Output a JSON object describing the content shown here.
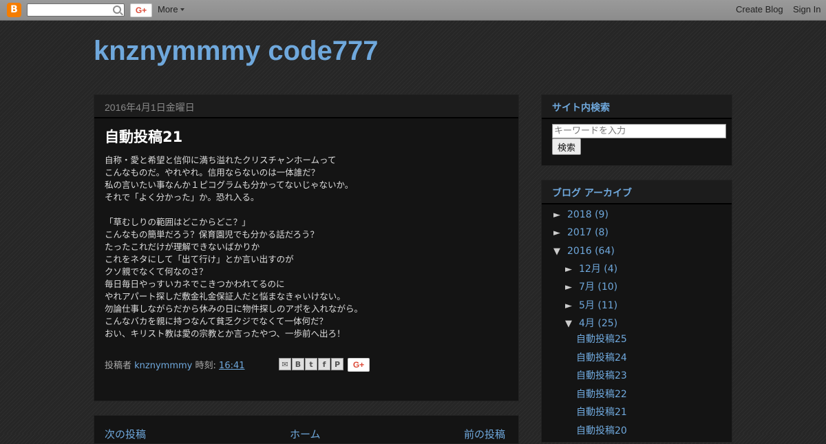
{
  "navbar": {
    "logo_glyph": "B",
    "gplus_label": "G+",
    "more_label": "More",
    "create_blog_label": "Create Blog",
    "sign_in_label": "Sign In"
  },
  "header": {
    "blog_title": "knznymmmy code777"
  },
  "post": {
    "date": "2016年4月1日金曜日",
    "title": "自動投稿21",
    "body_lines": [
      "自称・愛と希望と信仰に満ち溢れたクリスチャンホームって",
      "こんなものだ。やれやれ。信用ならないのは一体誰だ？",
      "私の言いたい事なんか１ピコグラムも分かってないじゃないか。",
      "それで「よく分かった」か。恐れ入る。",
      "",
      "「草むしりの範囲はどこからどこ？」",
      "こんなもの簡単だろう？保育園児でも分かる話だろう？",
      "たったこれだけが理解できないばかりか",
      "これをネタにして「出て行け」とか言い出すのが",
      "クソ親でなくて何なのさ？",
      "毎日毎日やっすいカネでこきつかわれてるのに",
      "やれアパート探しだ敷金礼金保証人だと悩まなきゃいけない。",
      "勿論仕事しながらだから休みの日に物件探しのアポを入れながら。",
      "こんなバカを親に持つなんて貧乏クジでなくて一体何だ？",
      "おい、キリスト教は愛の宗教とか言ったやつ、一歩前へ出ろ！"
    ],
    "posted_by_label": "投稿者",
    "author": "knznymmmy",
    "time_label": "時刻:",
    "time": "16:41",
    "share_gplus_label": "G+"
  },
  "pager": {
    "newer": "次の投稿",
    "home": "ホーム",
    "older": "前の投稿"
  },
  "sidebar": {
    "search": {
      "title": "サイト内検索",
      "placeholder": "キーワードを入力",
      "button": "検索"
    },
    "archive": {
      "title": "ブログ アーカイブ",
      "years": [
        {
          "toggle": "►",
          "label": "2018 (9)"
        },
        {
          "toggle": "►",
          "label": "2017 (8)"
        },
        {
          "toggle": "▼",
          "label": "2016 (64)"
        }
      ],
      "months": [
        {
          "toggle": "►",
          "label": "12月 (4)"
        },
        {
          "toggle": "►",
          "label": "7月 (10)"
        },
        {
          "toggle": "►",
          "label": "5月 (11)"
        },
        {
          "toggle": "▼",
          "label": "4月 (25)"
        }
      ],
      "posts": [
        "自動投稿25",
        "自動投稿24",
        "自動投稿23",
        "自動投稿22",
        "自動投稿21",
        "自動投稿20"
      ]
    }
  },
  "colors": {
    "link": "#6fa8dc",
    "navbar": "#8c8c8c",
    "panel": "#141414",
    "blogger_orange": "#f57d00"
  }
}
